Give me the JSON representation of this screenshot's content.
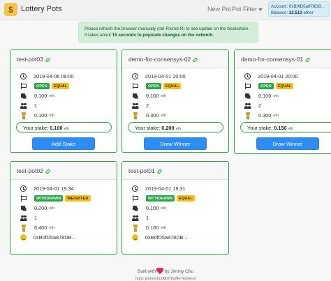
{
  "navbar": {
    "brand_icon": "money-bag-icon",
    "title": "Lottery Pots",
    "new_pot": "New Pot",
    "pot_filter": "Pot Filter",
    "account_label": "Account:",
    "account_value": "0xB0fD5a878DB...",
    "balance_label": "Balance:",
    "balance_value": "22.513",
    "balance_unit": "ether"
  },
  "alert": {
    "line1": "Please refresh the browser manually (ctrl-R/cmd-R) to see update on the blockchain.",
    "line2_prefix": "It takes about",
    "line2_bold": "15 seconds to populate changes on the network.",
    "color": "#d4edda"
  },
  "colors": {
    "accent": "#28a745",
    "primary": "#2d8df6",
    "warning": "#ffc107"
  },
  "pots": [
    {
      "name": "test-pot03",
      "time": "2019-04-06 09:00",
      "status": "OPEN",
      "type": "EQUAL",
      "amount": "0.100",
      "participants": "1",
      "prize": "0.100",
      "unit": "eth",
      "stake_label": "Your stake:",
      "stake": "0.100",
      "action": "Add Stake"
    },
    {
      "name": "demo-for-consensys-02",
      "time": "2019-04-01 20:00",
      "status": "OPEN",
      "type": "EQUAL",
      "amount": "0.100",
      "participants": "2",
      "prize": "0.300",
      "unit": "eth",
      "stake_label": "Your stake:",
      "stake": "0.200",
      "action": "Draw Winner"
    },
    {
      "name": "demo-for-consensys-01",
      "time": "2019-04-01 20:00",
      "status": "OPEN",
      "type": "EQUAL",
      "amount": "0.100",
      "participants": "2",
      "prize": "0.300",
      "unit": "eth",
      "stake_label": "Your stake:",
      "stake": "0.150",
      "action": "Draw Winner"
    },
    {
      "name": "test-pot02",
      "time": "2019-04-01 19:34",
      "status": "WITHDRAWN",
      "type": "WEIGHTED",
      "amount": "0.200",
      "participants": "1",
      "prize": "0.400",
      "unit": "eth",
      "winner": "0xB0fD5a878DB..."
    },
    {
      "name": "test-pot01",
      "time": "2019-04-01 19:31",
      "status": "WITHDRAWN",
      "type": "EQUAL",
      "amount": "0.100",
      "participants": "1",
      "prize": "0.100",
      "unit": "eth",
      "winner": "0xB0fD5a878DB..."
    }
  ],
  "footer": {
    "built_with": "Built with",
    "by": "by Jimmy Chu",
    "repo": "repo: jimmychu0807/truffle-frontend"
  }
}
